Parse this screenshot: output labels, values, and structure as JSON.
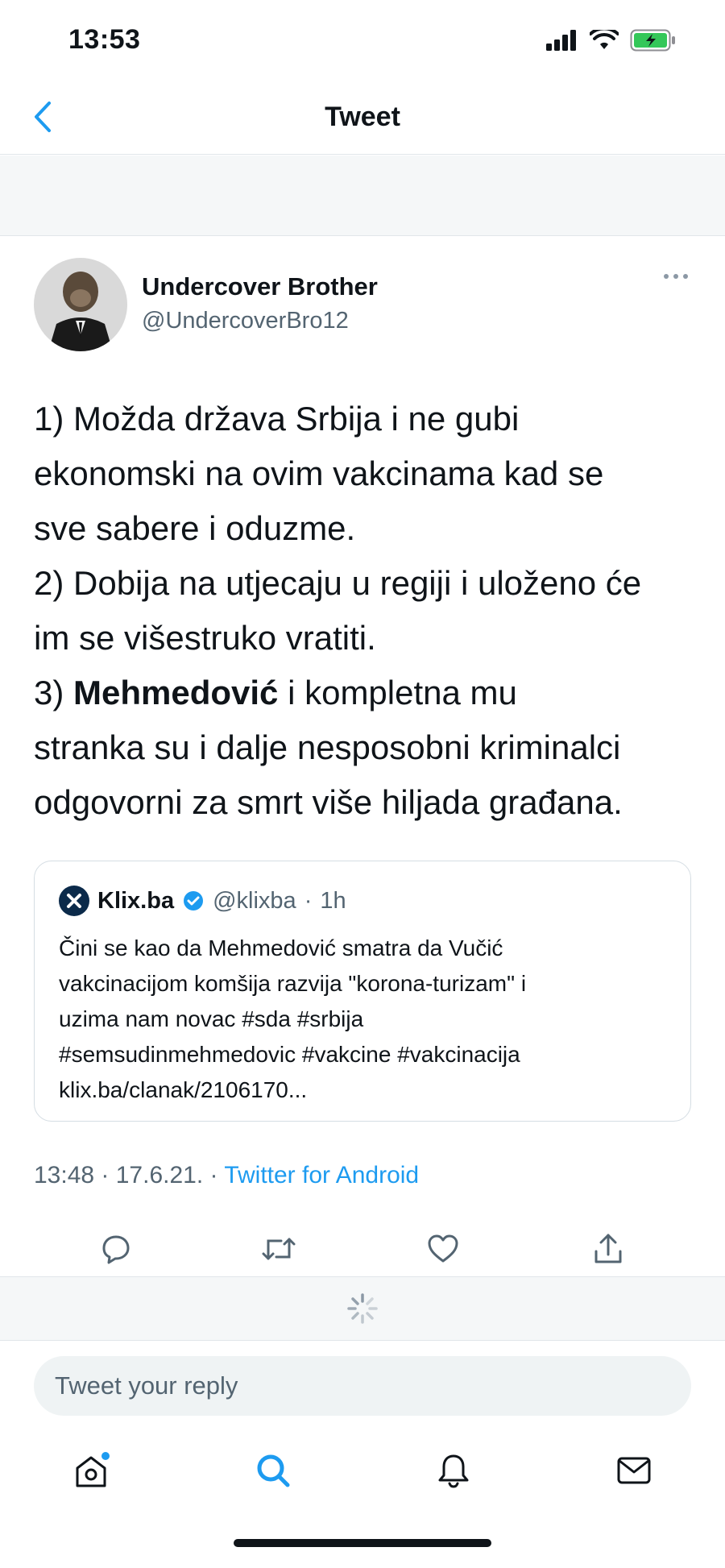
{
  "status_bar": {
    "time": "13:53"
  },
  "nav": {
    "title": "Tweet"
  },
  "tweet": {
    "author_name": "Undercover Brother",
    "author_handle": "@UndercoverBro12",
    "lines": [
      "1) Možda država Srbija i ne gubi",
      "ekonomski na ovim vakcinama kad se",
      "sve sabere i oduzme.",
      "2) Dobija na utjecaju u regiji i uloženo će",
      "im se višestruko vratiti."
    ],
    "line6_prefix": "3) ",
    "line6_bold": "Mehmedović",
    "line6_rest": " i kompletna mu",
    "lines_end": [
      "stranka su i dalje nesposobni kriminalci",
      "odgovorni za smrt više hiljada građana."
    ],
    "time": "13:48",
    "date": "17.6.21.",
    "source": "Twitter for Android"
  },
  "quote": {
    "name": "Klix.ba",
    "handle": "@klixba",
    "age": "1h",
    "lines": [
      "Čini se kao da Mehmedović smatra da Vučić",
      "vakcinacijom komšija razvija \"korona-turizam\" i",
      "uzima nam novac #sda #srbija",
      "#semsudinmehmedovic #vakcine #vakcinacija",
      "klix.ba/clanak/2106170..."
    ]
  },
  "reply": {
    "placeholder": "Tweet your reply"
  },
  "colors": {
    "accent": "#1d9bf0",
    "secondary_text": "#536471",
    "battery": "#34c759"
  },
  "icons": [
    "back-icon",
    "more-icon",
    "verified-icon",
    "reply-icon",
    "retweet-icon",
    "like-icon",
    "share-icon",
    "loading-spinner-icon",
    "home-icon",
    "search-icon",
    "notifications-icon",
    "messages-icon"
  ]
}
